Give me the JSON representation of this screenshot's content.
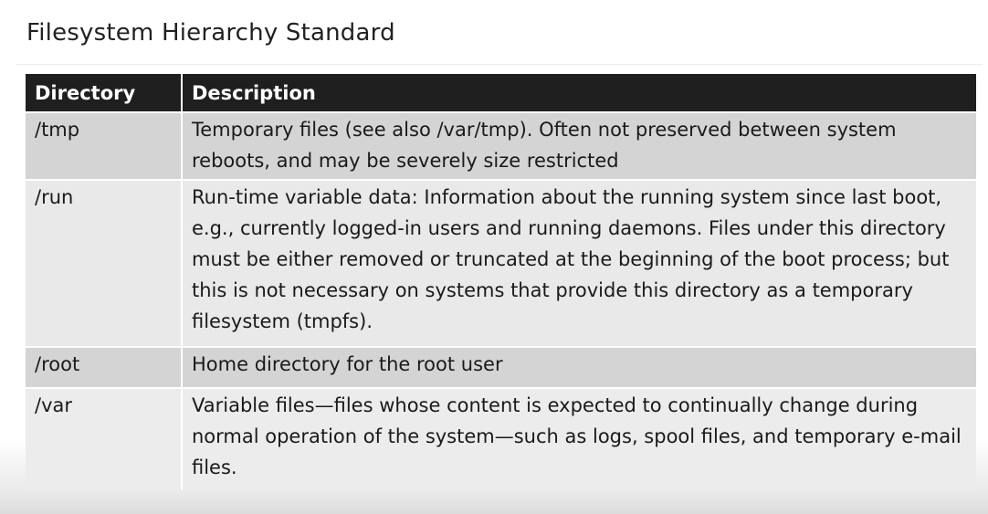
{
  "title": "Filesystem Hierarchy Standard",
  "table": {
    "headers": [
      "Directory",
      "Description"
    ],
    "rows": [
      {
        "directory": "/tmp",
        "description": "Temporary files (see also /var/tmp). Often not preserved between system reboots, and may be severely size restricted"
      },
      {
        "directory": "/run",
        "description": "Run-time variable data: Information about the running system since last boot, e.g., currently logged-in users and running daemons. Files under this directory must be either removed or truncated at the beginning of the boot process; but this is not necessary on systems that provide this directory as a temporary filesystem (tmpfs)."
      },
      {
        "directory": "/root",
        "description": "Home directory for the root user"
      },
      {
        "directory": "/var",
        "description": "Variable files—files whose content is expected to continually change during normal operation of the system—such as logs, spool files, and temporary e-mail files."
      }
    ]
  }
}
